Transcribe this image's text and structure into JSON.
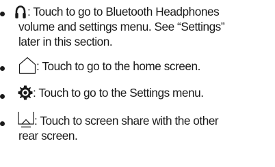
{
  "items": [
    {
      "icon": "headphones-icon",
      "lines": [
        ": Touch to go to Bluetooth Headphones",
        "volume and settings menu. See “Settings”",
        "later in this section."
      ]
    },
    {
      "icon": "home-icon",
      "lines": [
        ": Touch to go to the home screen."
      ]
    },
    {
      "icon": "gear-icon",
      "lines": [
        ": Touch to go to the Settings menu."
      ]
    },
    {
      "icon": "screen-share-icon",
      "lines": [
        ": Touch to screen share with the other",
        "rear screen."
      ]
    }
  ]
}
